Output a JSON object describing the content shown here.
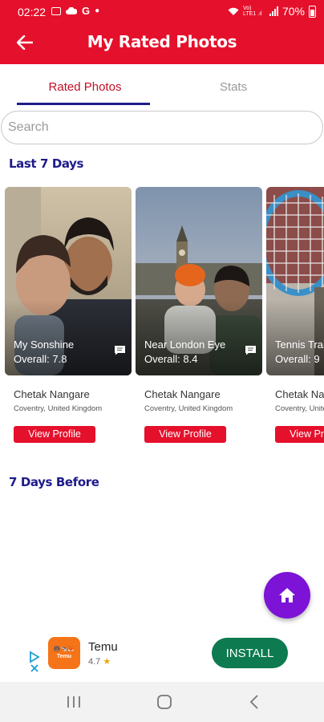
{
  "status_bar": {
    "time": "02:22",
    "battery_pct": "70%",
    "network_label": "Vo) LTE1 .ıl"
  },
  "header": {
    "title": "My Rated Photos"
  },
  "tabs": [
    {
      "label": "Rated Photos",
      "selected": true
    },
    {
      "label": "Stats",
      "selected": false
    }
  ],
  "search": {
    "placeholder": "Search",
    "value": ""
  },
  "sections": {
    "last7": "Last 7 Days",
    "before7": "7 Days Before"
  },
  "cards": [
    {
      "title": "My Sonshine",
      "score": "Overall: 7.8",
      "user": "Chetak Nangare",
      "location": "Coventry, United Kingdom",
      "button": "View Profile"
    },
    {
      "title": "Near London Eye",
      "score": "Overall: 8.4",
      "user": "Chetak Nangare",
      "location": "Coventry, United Kingdom",
      "button": "View Profile"
    },
    {
      "title": "Tennis Training",
      "score": "Overall: 9",
      "user": "Chetak Nangare",
      "location": "Coventry, United Kingdom",
      "button": "View Profile"
    }
  ],
  "ad": {
    "app_name": "Temu",
    "rating": "4.7",
    "logo_text": "Temu",
    "install_label": "INSTALL"
  },
  "colors": {
    "primary": "#e5102b",
    "accent": "#1e1b8a",
    "fab": "#7c13d6",
    "install": "#0d7a50"
  }
}
